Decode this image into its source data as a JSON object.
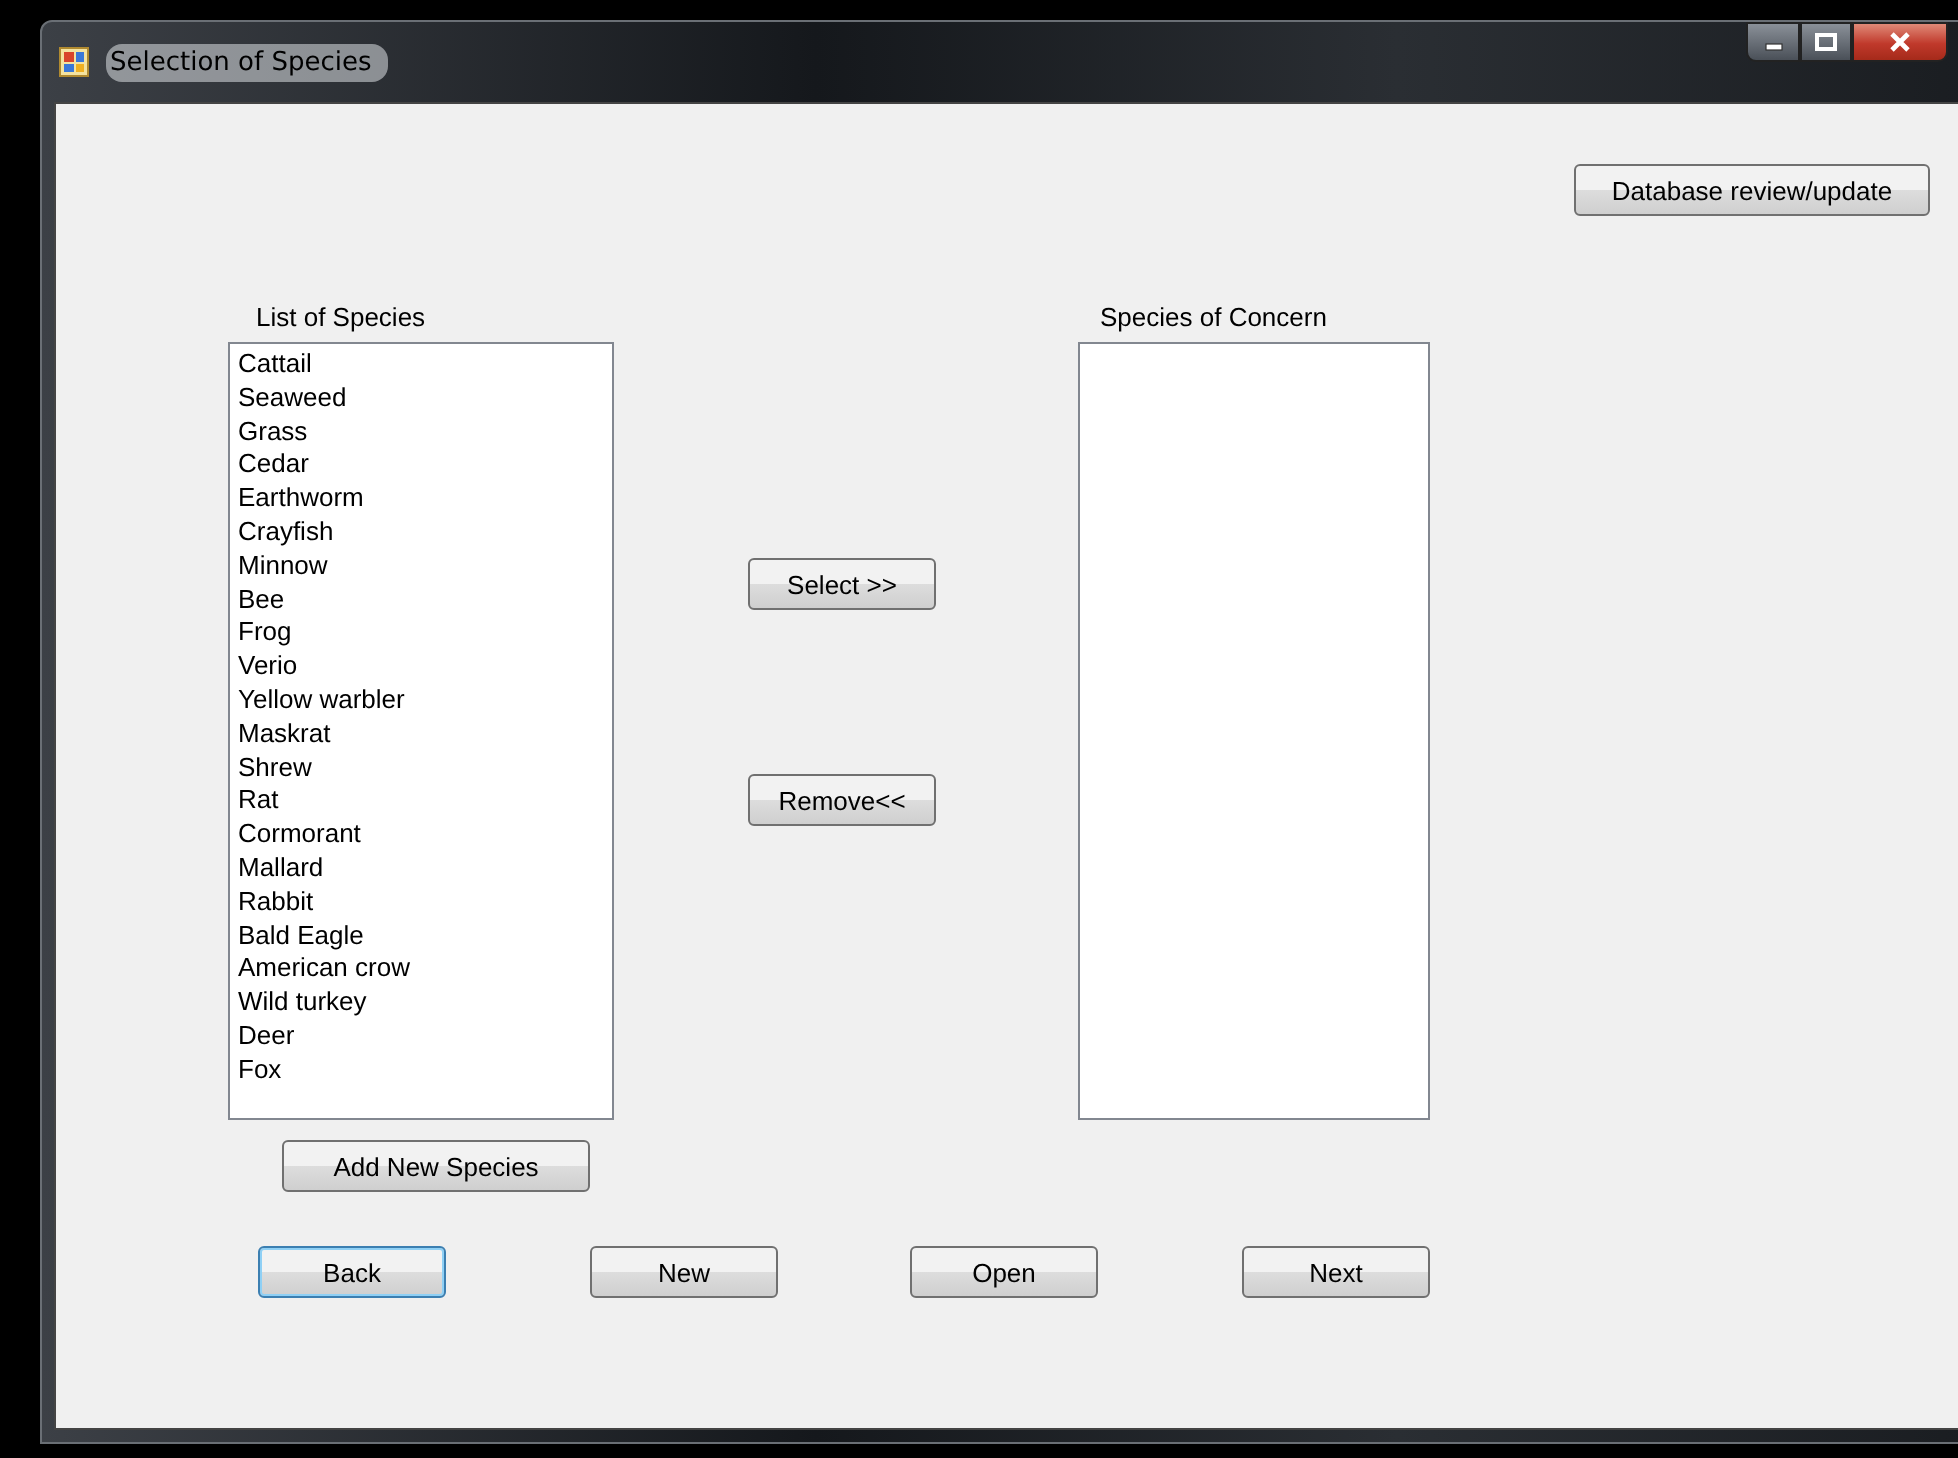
{
  "window": {
    "title": "Selection of Species"
  },
  "database_button": {
    "label": "Database review/update",
    "focused": false
  },
  "species_list": {
    "label": "List of Species",
    "items": [
      "Cattail",
      "Seaweed",
      "Grass",
      "Cedar",
      "Earthworm",
      "Crayfish",
      "Minnow",
      "Bee",
      "Frog",
      "Verio",
      "Yellow warbler",
      "Maskrat",
      "Shrew",
      "Rat",
      "Cormorant",
      "Mallard",
      "Rabbit",
      "Bald Eagle",
      "American crow",
      "Wild turkey",
      "Deer",
      "Fox"
    ]
  },
  "transfer_buttons": [
    {
      "label": "Select >>",
      "focused": false
    },
    {
      "label": "Remove<<",
      "focused": false
    }
  ],
  "concern_list": {
    "label": "Species of Concern"
  },
  "add_button": {
    "label": "Add New Species",
    "focused": false
  },
  "nav_buttons": [
    {
      "label": "Back",
      "focused": true
    },
    {
      "label": "New",
      "focused": false
    },
    {
      "label": "Open",
      "focused": false
    },
    {
      "label": "Next",
      "focused": false
    }
  ]
}
